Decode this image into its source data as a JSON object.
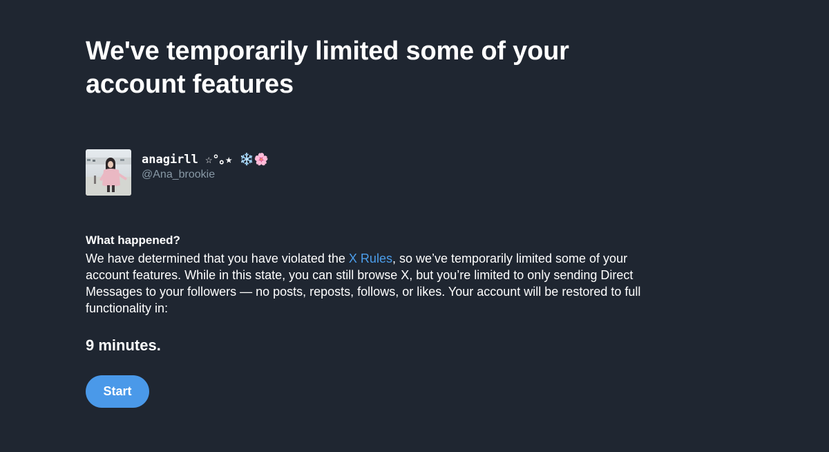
{
  "page": {
    "title": "We've temporarily limited some of your account features"
  },
  "account": {
    "display_name": "anagirll ☆°｡★ ❄️🌸",
    "handle": "@Ana_brookie",
    "avatar_icon": "profile-photo"
  },
  "notice": {
    "heading": "What happened?",
    "text_before_link": "We have determined that you have violated the ",
    "link_text": "X Rules",
    "text_after_link": ", so we’ve temporarily limited some of your account features. While in this state, you can still browse X, but you’re limited to only sending Direct Messages to your followers — no posts, reposts, follows, or likes. Your account will be restored to full functionality in:"
  },
  "countdown": {
    "value": "9 minutes."
  },
  "actions": {
    "start_label": "Start"
  },
  "colors": {
    "background": "#1f2631",
    "link": "#4c9eeb",
    "button": "#4a99e9",
    "muted_text": "#8899a6"
  }
}
